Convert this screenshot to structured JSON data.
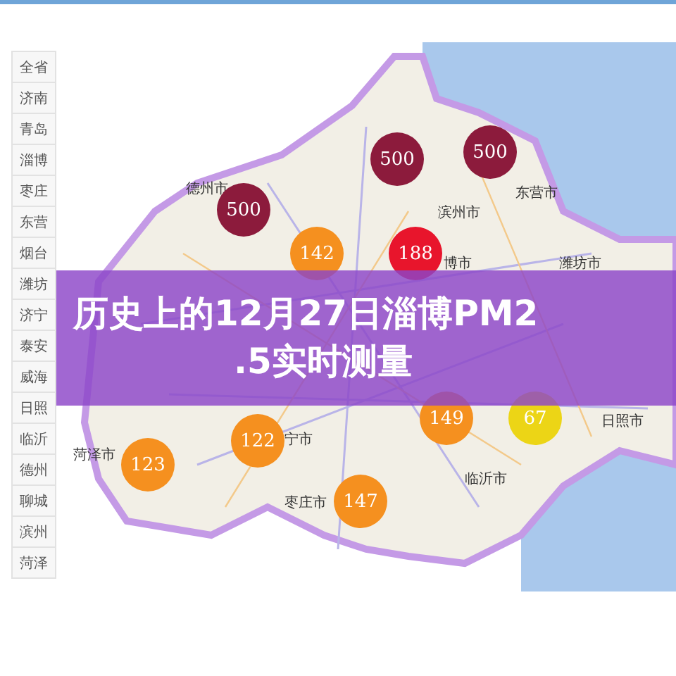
{
  "sidebar": {
    "items": [
      {
        "label": "全省"
      },
      {
        "label": "济南"
      },
      {
        "label": "青岛"
      },
      {
        "label": "淄博"
      },
      {
        "label": "枣庄"
      },
      {
        "label": "东营"
      },
      {
        "label": "烟台"
      },
      {
        "label": "潍坊"
      },
      {
        "label": "济宁"
      },
      {
        "label": "泰安"
      },
      {
        "label": "威海"
      },
      {
        "label": "日照"
      },
      {
        "label": "临沂"
      },
      {
        "label": "德州"
      },
      {
        "label": "聊城"
      },
      {
        "label": "滨州"
      },
      {
        "label": "菏泽"
      }
    ]
  },
  "map": {
    "markers": [
      {
        "value": "500",
        "color": "#8c1b3c"
      },
      {
        "value": "500",
        "color": "#8c1b3c"
      },
      {
        "value": "500",
        "color": "#8c1b3c"
      },
      {
        "value": "142",
        "color": "#f5901f"
      },
      {
        "value": "188",
        "color": "#e8152c"
      },
      {
        "value": "149",
        "color": "#f5901f"
      },
      {
        "value": "67",
        "color": "#ecd516"
      },
      {
        "value": "122",
        "color": "#f5901f"
      },
      {
        "value": "123",
        "color": "#f5901f"
      },
      {
        "value": "147",
        "color": "#f5901f"
      }
    ],
    "labels": [
      {
        "text": "德州市"
      },
      {
        "text": "滨州市"
      },
      {
        "text": "东营市"
      },
      {
        "text": "潍坊市"
      },
      {
        "text": "博市"
      },
      {
        "text": "日照市"
      },
      {
        "text": "宁市"
      },
      {
        "text": "菏泽市"
      },
      {
        "text": "临沂市"
      },
      {
        "text": "枣庄市"
      }
    ]
  },
  "banner": {
    "lines": [
      "历史上的12月27日淄博PM2",
      ".5实时测量"
    ]
  }
}
